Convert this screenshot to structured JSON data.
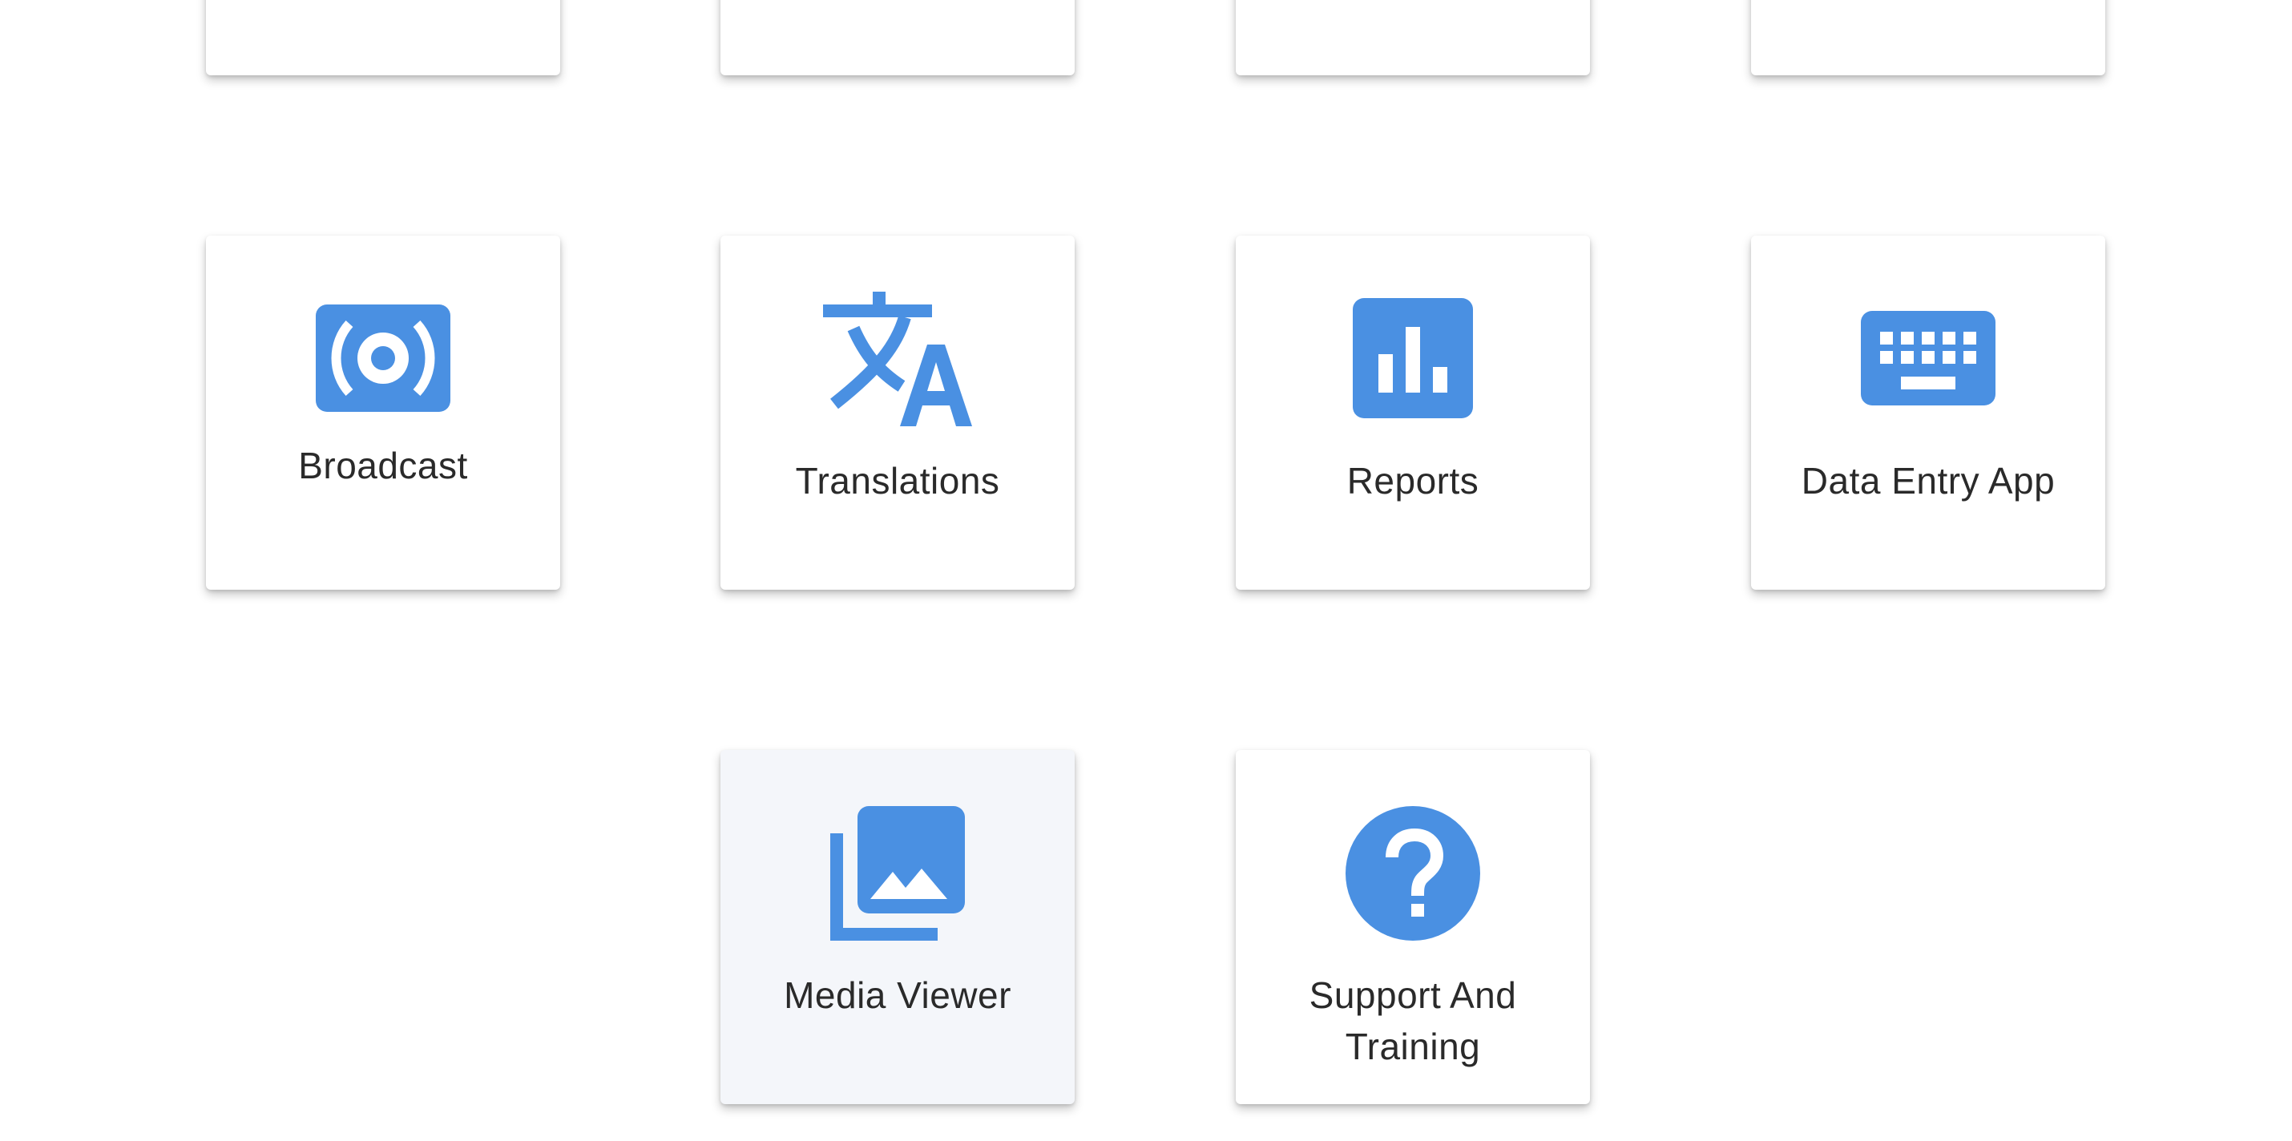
{
  "accent_color": "#4a90e2",
  "tiles_top_row": [
    {
      "label": ""
    },
    {
      "label": ""
    },
    {
      "label": ""
    },
    {
      "label": ""
    }
  ],
  "tiles": [
    {
      "label": "Broadcast",
      "icon": "broadcast-icon"
    },
    {
      "label": "Translations",
      "icon": "translate-icon"
    },
    {
      "label": "Reports",
      "icon": "bar-chart-icon"
    },
    {
      "label": "Data Entry App",
      "icon": "keyboard-icon"
    },
    {
      "label": "Media Viewer",
      "icon": "photo-library-icon",
      "selected": true
    },
    {
      "label": "Support And Training",
      "icon": "help-circle-icon"
    }
  ]
}
